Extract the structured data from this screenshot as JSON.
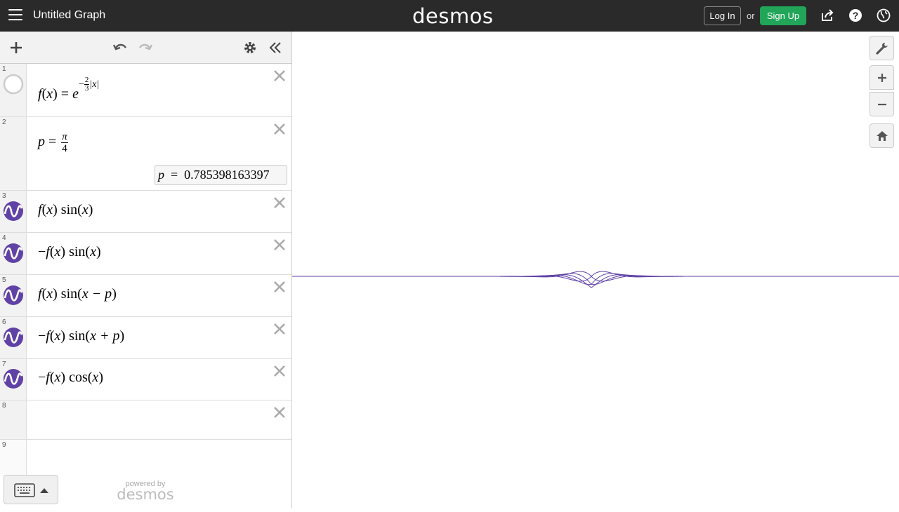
{
  "header": {
    "title": "Untitled Graph",
    "logo": "desmos",
    "login_label": "Log In",
    "or_text": "or",
    "signup_label": "Sign Up",
    "icons": [
      "menu-icon",
      "share-icon",
      "help-icon",
      "globe-icon"
    ]
  },
  "toolbar": {
    "icons": [
      "add-icon",
      "undo-icon",
      "redo-icon",
      "settings-icon",
      "collapse-icon"
    ]
  },
  "expressions": [
    {
      "num": "1",
      "latex": "f(x) = e^{-\\frac{2}{3}|x|}",
      "f": "f",
      "x": "x",
      "eq": "=",
      "e": "e",
      "sup_neg": "−",
      "sup_num": "2",
      "sup_den": "3",
      "abs": "|x|",
      "icon": "hidden-circle"
    },
    {
      "num": "2",
      "latex": "p = \\frac{\\pi}{4}",
      "p": "p",
      "eq": "=",
      "pi": "π",
      "den": "4",
      "eval_var": "p",
      "eval_eq": "=",
      "eval_value": "0.785398163397"
    },
    {
      "num": "3",
      "latex": "f(x) sin(x)",
      "pre": "",
      "f": "f",
      "x": "x",
      "func": "sin",
      "arg": "x",
      "icon": "graph-wave"
    },
    {
      "num": "4",
      "latex": "-f(x) sin(x)",
      "pre": "−",
      "f": "f",
      "x": "x",
      "func": "sin",
      "arg": "x",
      "icon": "graph-wave"
    },
    {
      "num": "5",
      "latex": "f(x) sin(x-p)",
      "pre": "",
      "f": "f",
      "x": "x",
      "func": "sin",
      "arg": "x − p",
      "icon": "graph-wave"
    },
    {
      "num": "6",
      "latex": "-f(x) sin(x+p)",
      "pre": "−",
      "f": "f",
      "x": "x",
      "func": "sin",
      "arg": "x + p",
      "icon": "graph-wave"
    },
    {
      "num": "7",
      "latex": "-f(x) cos(x)",
      "pre": "−",
      "f": "f",
      "x": "x",
      "func": "cos",
      "arg": "x",
      "icon": "graph-wave"
    },
    {
      "num": "8"
    },
    {
      "num": "9"
    }
  ],
  "footer": {
    "powered_by": "powered by",
    "powered_logo": "desmos"
  },
  "graph_controls": [
    "wrench-icon",
    "zoom-in-icon",
    "zoom-out-icon",
    "home-icon"
  ],
  "colors": {
    "header_bg": "#2a2a2a",
    "signup_green": "#21a559",
    "curve_purple": "#6042a6"
  }
}
